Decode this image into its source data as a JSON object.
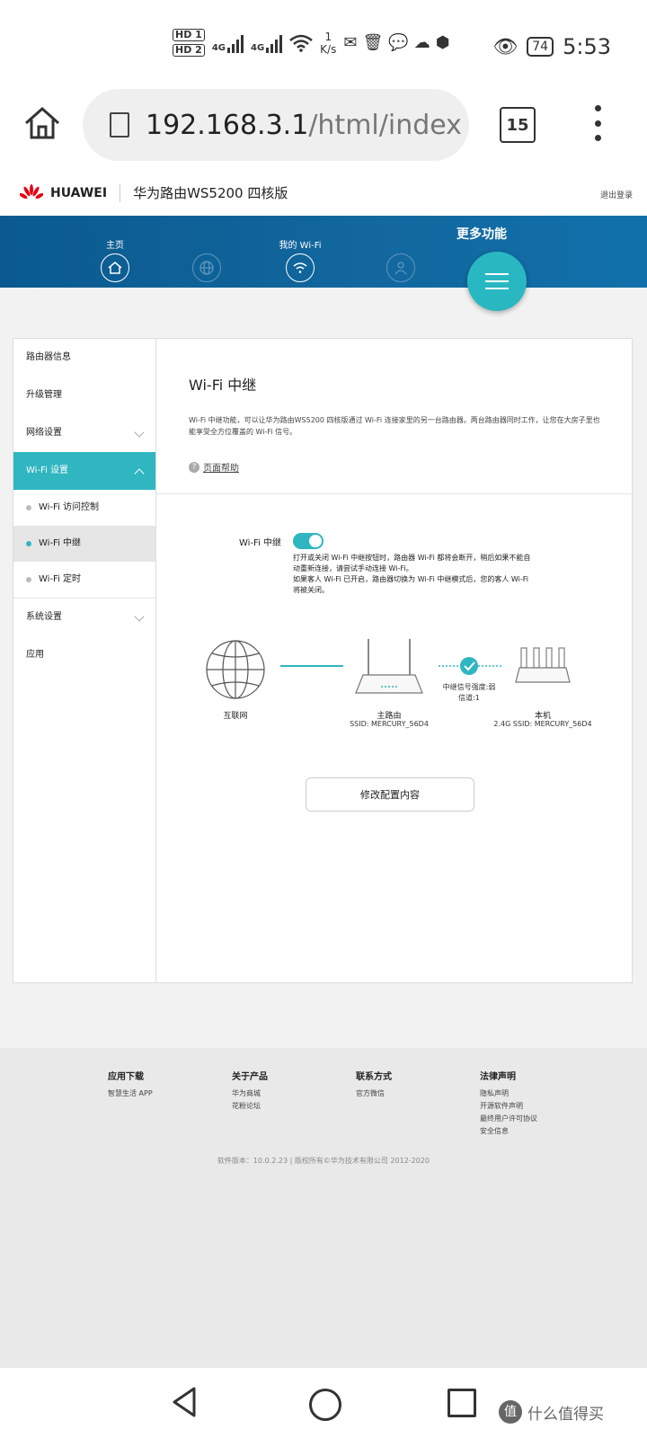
{
  "status_bar": {
    "hd1": "HD 1",
    "hd2": "HD 2",
    "net1": "4G",
    "net2": "4G",
    "speed_value": "1",
    "speed_unit": "K/s",
    "battery": "74",
    "time": "5:53"
  },
  "browser": {
    "url_host": "192.168.3.1",
    "url_path": "/html/index",
    "tab_count": "15"
  },
  "header": {
    "brand": "HUAWEI",
    "model": "华为路由WS5200 四核版",
    "logout": "退出登录"
  },
  "nav": {
    "items": [
      {
        "label": "主页"
      },
      {
        "label": ""
      },
      {
        "label": "我的 Wi-Fi"
      },
      {
        "label": ""
      }
    ],
    "more_label": "更多功能"
  },
  "sidebar": {
    "items": [
      {
        "label": "路由器信息"
      },
      {
        "label": "升级管理"
      },
      {
        "label": "网络设置"
      },
      {
        "label": "Wi-Fi 设置"
      },
      {
        "label": "系统设置"
      },
      {
        "label": "应用"
      }
    ],
    "sub_items": [
      {
        "label": "Wi-Fi 访问控制"
      },
      {
        "label": "Wi-Fi 中继"
      },
      {
        "label": "Wi-Fi 定时"
      }
    ]
  },
  "content": {
    "title": "Wi-Fi 中继",
    "description": "Wi-Fi 中继功能，可以让华为路由WS5200 四核版通过 Wi-Fi 连接家里的另一台路由器。两台路由器同时工作，让您在大房子里也能享受全方位覆盖的 Wi-Fi 信号。",
    "help": "页面帮助",
    "toggle_label": "Wi-Fi 中继",
    "toggle_on": true,
    "toggle_note_1": "打开或关闭 Wi-Fi 中继按钮时，路由器 Wi-Fi 都将会断开，稍后如果不能自动重新连接，请尝试手动连接 Wi-Fi。",
    "toggle_note_2": "如果客人 Wi-Fi 已开启，路由器切换为 Wi-Fi 中继模式后，您的客人 Wi-Fi 将被关闭。",
    "diagram": {
      "internet": "互联网",
      "main_router": "主路由",
      "main_ssid": "SSID: MERCURY_56D4",
      "signal": "中继信号强度:弱",
      "channel": "信道:1",
      "this_device": "本机",
      "this_ssid": "2.4G SSID:  MERCURY_56D4"
    },
    "edit_button": "修改配置内容"
  },
  "footer": {
    "columns": [
      {
        "title": "应用下载",
        "links": [
          "智慧生活 APP"
        ]
      },
      {
        "title": "关于产品",
        "links": [
          "华为商城",
          "花粉论坛"
        ]
      },
      {
        "title": "联系方式",
        "links": [
          "官方微信"
        ]
      },
      {
        "title": "法律声明",
        "links": [
          "隐私声明",
          "开源软件声明",
          "最终用户许可协议",
          "安全信息"
        ]
      }
    ],
    "copyright": "软件版本：10.0.2.23 | 版权所有©华为技术有限公司 2012-2020"
  },
  "watermark": {
    "badge": "值",
    "text": "什么值得买"
  },
  "colors": {
    "accent": "#2fb6c1",
    "nav_blue": "#0a5a8f"
  }
}
